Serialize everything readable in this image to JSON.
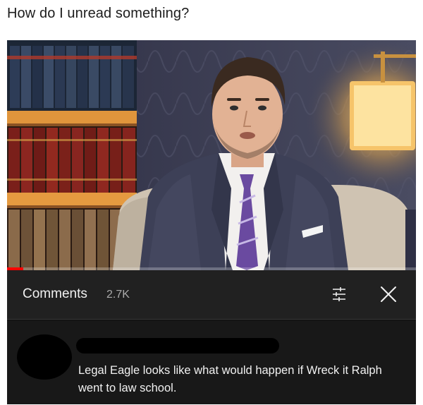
{
  "post": {
    "caption": "How do I unread something?"
  },
  "video": {
    "description_icons": [
      "bookshelf",
      "lamp",
      "man-in-suit"
    ],
    "progress_fraction": 0.04,
    "progress_color": "#ff0000"
  },
  "comments_panel": {
    "title": "Comments",
    "count": "2.7K",
    "sort_icon": "sort-filter-icon",
    "close_icon": "close-icon"
  },
  "comment": {
    "text": "Legal Eagle looks like what would happen if Wreck it Ralph went to law school."
  },
  "colors": {
    "panel_bg": "#212121",
    "comment_bg": "#181818",
    "text_primary": "#f1f1f1",
    "text_secondary": "#aaaaaa"
  }
}
